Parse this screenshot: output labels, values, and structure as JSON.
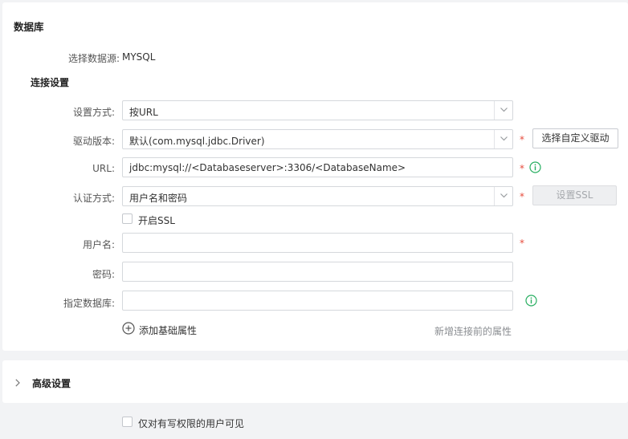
{
  "database": {
    "title": "数据库",
    "datasource_label": "选择数据源:",
    "datasource_value": "MYSQL"
  },
  "connection": {
    "title": "连接设置",
    "method_label": "设置方式:",
    "method_value": "按URL",
    "driver_label": "驱动版本:",
    "driver_value": "默认(com.mysql.jdbc.Driver)",
    "custom_driver_button": "选择自定义驱动",
    "url_label": "URL:",
    "url_value": "jdbc:mysql://<Databaseserver>:3306/<DatabaseName>",
    "auth_label": "认证方式:",
    "auth_value": "用户名和密码",
    "ssl_button": "设置SSL",
    "ssl_checkbox_label": "开启SSL",
    "username_label": "用户名:",
    "password_label": "密码:",
    "specify_db_label": "指定数据库:",
    "add_property_label": "添加基础属性",
    "new_pre_connect_label": "新增连接前的属性",
    "required_mark": "*"
  },
  "advanced": {
    "title": "高级设置"
  },
  "footer": {
    "write_only_label": "仅对有写权限的用户可见"
  },
  "colors": {
    "required": "#e74c3c",
    "info": "#27ae60",
    "border": "#d5d8dc"
  }
}
